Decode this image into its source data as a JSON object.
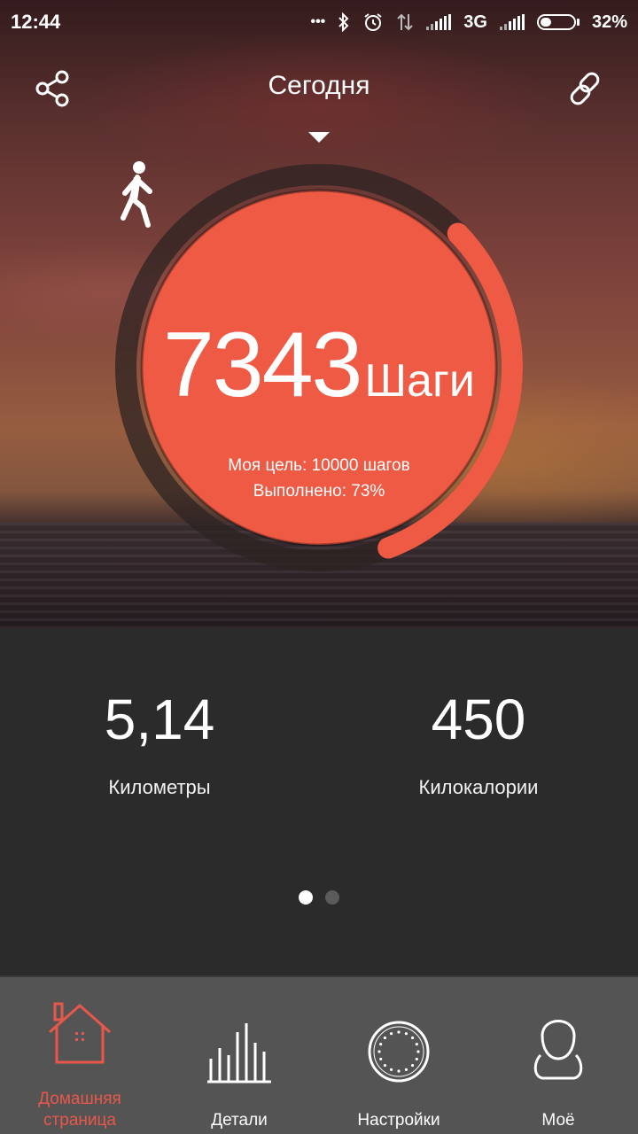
{
  "status_bar": {
    "time": "12:44",
    "dots": "•••",
    "network": "3G",
    "battery_percent": "32%",
    "battery_level": 0.32,
    "icons": [
      "bluetooth-icon",
      "alarm-icon",
      "data-arrows-icon",
      "signal-icon",
      "signal-icon",
      "battery-icon"
    ]
  },
  "header": {
    "title": "Сегодня",
    "share_icon": "share-icon",
    "link_icon": "link-icon",
    "dropdown_icon": "triangle-down-icon"
  },
  "steps": {
    "icon": "walking-person-icon",
    "value": "7343",
    "unit": "Шаги",
    "goal_text": "Моя цель: 10000 шагов",
    "done_text": "Выполнено: 73%",
    "progress_fraction": 0.73
  },
  "stats": [
    {
      "value": "5,14",
      "label": "Километры"
    },
    {
      "value": "450",
      "label": "Килокалории"
    }
  ],
  "pager": {
    "count": 2,
    "active": 0
  },
  "nav": [
    {
      "label": "Домашняя\nстраница",
      "icon": "home-icon",
      "active": true
    },
    {
      "label": "Детали",
      "icon": "bar-chart-icon",
      "active": false
    },
    {
      "label": "Настройки",
      "icon": "dial-settings-icon",
      "active": false
    },
    {
      "label": "Моё",
      "icon": "profile-icon",
      "active": false
    }
  ],
  "colors": {
    "accent": "#ef5a45",
    "ring_track": "#2c2322",
    "panel": "#2b2b2b",
    "nav_bg": "#545454",
    "nav_active": "#e8584a"
  }
}
